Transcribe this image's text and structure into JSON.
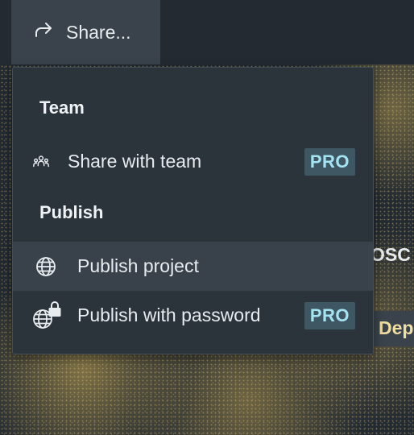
{
  "toolbar": {
    "share_label": "Share..."
  },
  "menu": {
    "sections": [
      {
        "title": "Team"
      },
      {
        "title": "Publish"
      }
    ],
    "items": [
      {
        "label": "Share with team",
        "badge": "PRO",
        "icon": "team-icon"
      },
      {
        "label": "Publish project",
        "icon": "globe-icon"
      },
      {
        "label": "Publish with password",
        "badge": "PRO",
        "icon": "globe-lock-icon"
      }
    ]
  },
  "background": {
    "peek_text_1": "OSC",
    "peek_text_2": "Dep"
  },
  "colors": {
    "menu_bg": "#2b333b",
    "hover_bg": "#39424b",
    "pro_badge_bg": "#3f5763",
    "pro_badge_text": "#a4e4f2"
  }
}
